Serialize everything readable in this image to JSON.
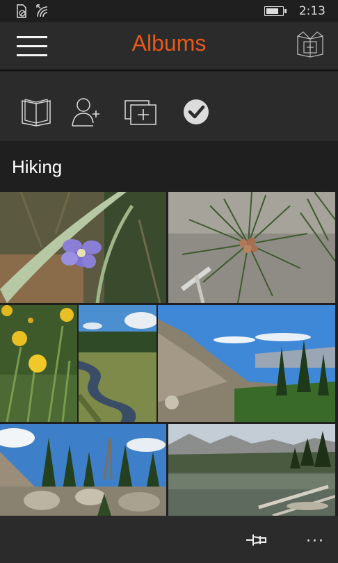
{
  "status_bar": {
    "time": "2:13",
    "battery_level": 0.75,
    "icons": [
      "sim-icon",
      "wifi-icon"
    ]
  },
  "header": {
    "title": "Albums",
    "title_color": "#e8591a",
    "menu_icon": "hamburger-icon",
    "right_icon": "add-album-icon"
  },
  "toolbar": {
    "buttons": [
      {
        "icon": "album-book-icon"
      },
      {
        "icon": "add-person-icon"
      },
      {
        "icon": "add-photos-icon"
      },
      {
        "icon": "select-check-icon"
      }
    ]
  },
  "album": {
    "name": "Hiking",
    "photos": [
      {
        "subject": "purple-flower"
      },
      {
        "subject": "pine-branch"
      },
      {
        "subject": "yellow-flowers"
      },
      {
        "subject": "meadow-stream"
      },
      {
        "subject": "mountain-hillside"
      },
      {
        "subject": "forest-rocks"
      },
      {
        "subject": "mountain-lake"
      }
    ]
  },
  "app_bar": {
    "buttons": [
      {
        "icon": "pin-icon"
      },
      {
        "icon": "more-icon",
        "label": "..."
      }
    ]
  }
}
